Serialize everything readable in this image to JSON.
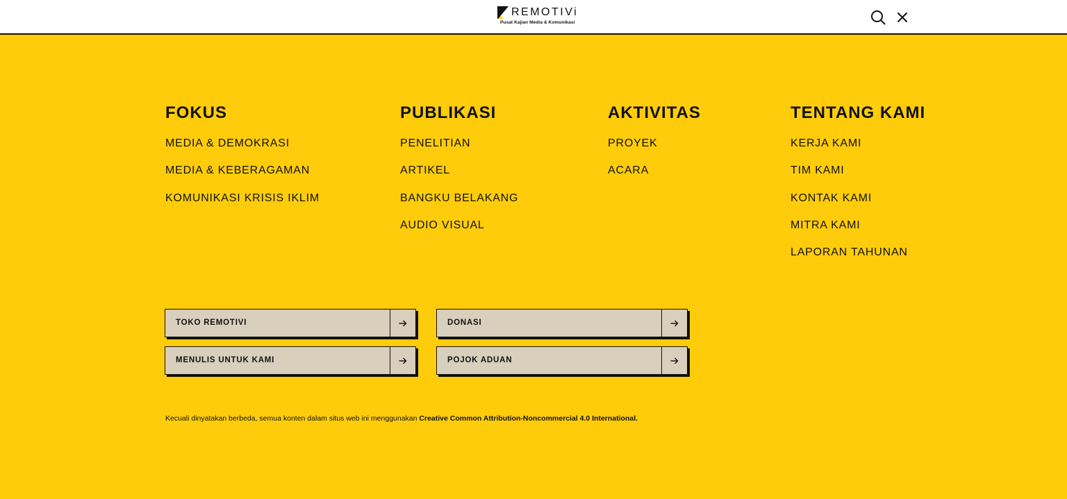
{
  "header": {
    "logo_word": "REMOTIVi",
    "logo_tagline": "Pusat Kajian Media & Komunikasi",
    "icons": {
      "search": "search-icon",
      "close": "close-icon"
    }
  },
  "columns": [
    {
      "title": "FOKUS",
      "items": [
        "MEDIA & DEMOKRASI",
        "MEDIA & KEBERAGAMAN",
        "KOMUNIKASI KRISIS IKLIM"
      ]
    },
    {
      "title": "PUBLIKASI",
      "items": [
        "PENELITIAN",
        "ARTIKEL",
        "BANGKU BELAKANG",
        "AUDIO VISUAL"
      ]
    },
    {
      "title": "AKTIVITAS",
      "items": [
        "PROYEK",
        "ACARA"
      ]
    },
    {
      "title": "TENTANG KAMI",
      "items": [
        "KERJA KAMI",
        "TIM KAMI",
        "KONTAK KAMI",
        "MITRA KAMI",
        "LAPORAN TAHUNAN"
      ]
    }
  ],
  "buttons": {
    "toko": "TOKO REMOTIVI",
    "donasi": "DONASI",
    "menulis": "MENULIS UNTUK KAMI",
    "pojok": "POJOK ADUAN",
    "arrow_icon": "arrow-right-icon"
  },
  "footer": {
    "text": "Kecuali dinyatakan berbeda, semua konten dalam situs web ini menggunakan ",
    "link": "Creative Common Attribution-Noncommercial 4.0 International."
  },
  "colors": {
    "background": "#fecc0a",
    "header_bg": "#ffffff",
    "button_bg": "#d8cfbc",
    "ink": "#111111"
  }
}
